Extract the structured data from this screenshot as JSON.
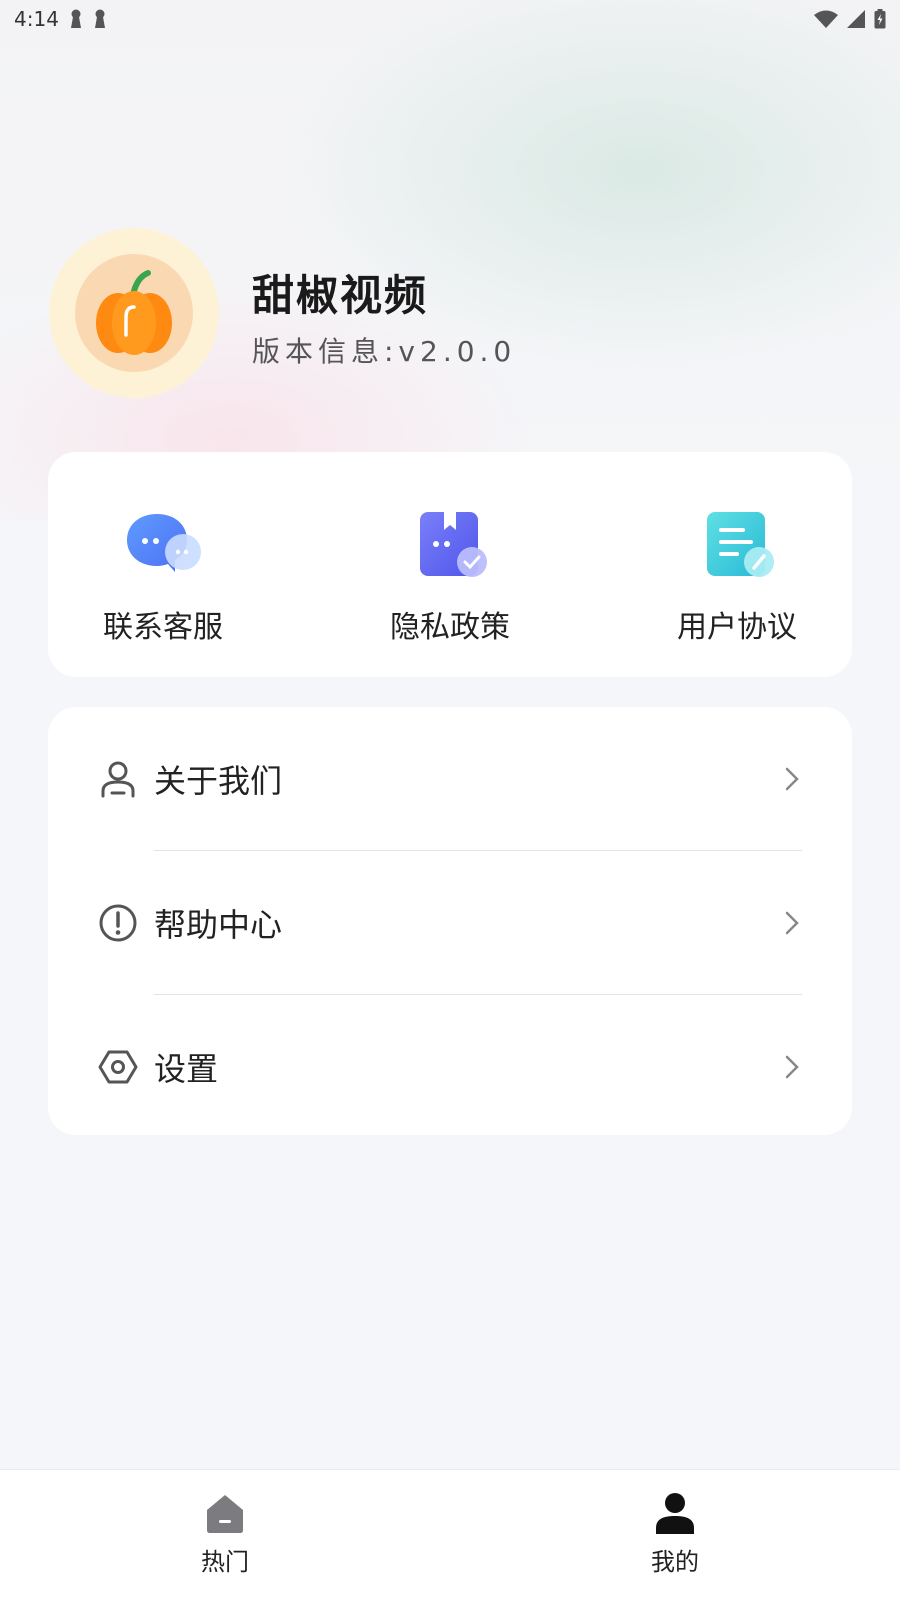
{
  "status_bar": {
    "time": "4:14"
  },
  "profile": {
    "app_name": "甜椒视频",
    "version": "版本信息:v2.0.0"
  },
  "quick_actions": [
    {
      "label": "联系客服",
      "icon": "chat-bubble-icon"
    },
    {
      "label": "隐私政策",
      "icon": "privacy-bookmark-icon"
    },
    {
      "label": "用户协议",
      "icon": "document-edit-icon"
    }
  ],
  "menu": [
    {
      "label": "关于我们",
      "icon": "user-outline-icon"
    },
    {
      "label": "帮助中心",
      "icon": "exclamation-circle-icon"
    },
    {
      "label": "设置",
      "icon": "settings-hexagon-icon"
    }
  ],
  "bottom_nav": [
    {
      "label": "热门",
      "icon": "home-icon",
      "active": false
    },
    {
      "label": "我的",
      "icon": "person-icon",
      "active": true
    }
  ],
  "colors": {
    "accent_blue": "#5b8dfb",
    "accent_indigo": "#6a6ff5",
    "accent_cyan": "#35c9dc",
    "avatar_bg": "#fdf2d6",
    "pumpkin": "#ff8a12"
  }
}
